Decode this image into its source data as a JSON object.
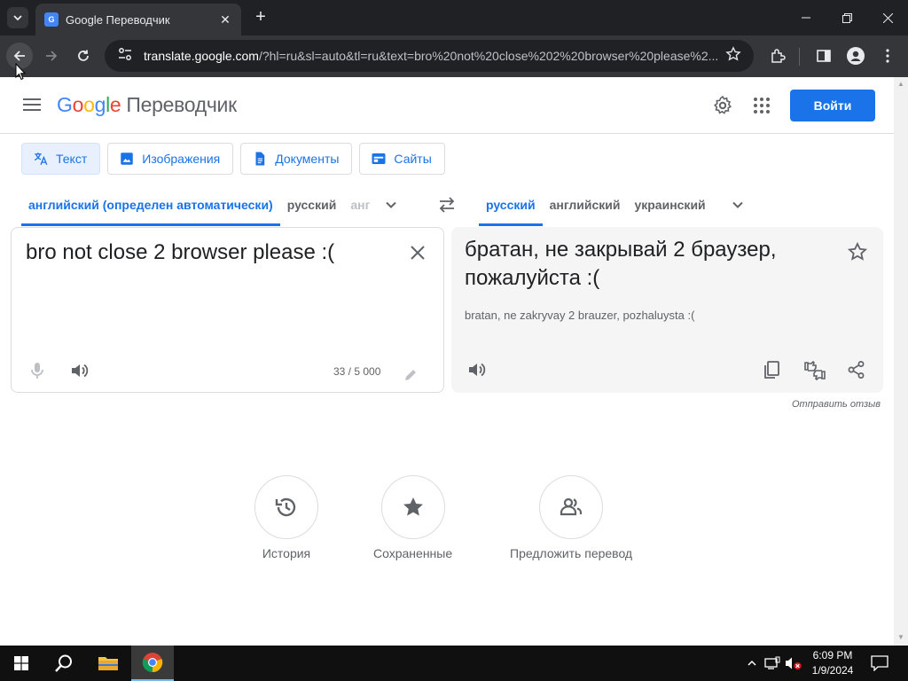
{
  "browser": {
    "tab_title": "Google Переводчик",
    "favicon_text": "G",
    "url_host": "translate.google.com",
    "url_rest": "/?hl=ru&sl=auto&tl=ru&text=bro%20not%20close%202%20browser%20please%2..."
  },
  "header": {
    "logo_letters": [
      "G",
      "o",
      "o",
      "g",
      "l",
      "e"
    ],
    "product_name": "Переводчик",
    "signin_label": "Войти"
  },
  "mode_tabs": [
    {
      "label": "Текст",
      "icon": "translate-icon",
      "active": true
    },
    {
      "label": "Изображения",
      "icon": "image-icon",
      "active": false
    },
    {
      "label": "Документы",
      "icon": "document-icon",
      "active": false
    },
    {
      "label": "Сайты",
      "icon": "website-icon",
      "active": false
    }
  ],
  "source_langs": [
    "английский (определен автоматически)",
    "русский",
    "анг"
  ],
  "target_langs": [
    "русский",
    "английский",
    "украинский"
  ],
  "source": {
    "text": "bro not close 2 browser please :(",
    "char_count": "33 / 5 000"
  },
  "target": {
    "text": "братан, не закрывай 2 браузер, пожалуйста :(",
    "transliteration": "bratan, ne zakryvay 2 brauzer, pozhaluysta :("
  },
  "feedback_label": "Отправить отзыв",
  "actions": [
    {
      "label": "История",
      "icon": "history-icon"
    },
    {
      "label": "Сохраненные",
      "icon": "star-icon"
    },
    {
      "label": "Предложить перевод",
      "icon": "community-icon"
    }
  ],
  "taskbar": {
    "time": "6:09 PM",
    "date": "1/9/2024"
  },
  "colors": {
    "accent": "#1a73e8",
    "chrome_dark": "#202124",
    "chrome_toolbar": "#35363a"
  }
}
